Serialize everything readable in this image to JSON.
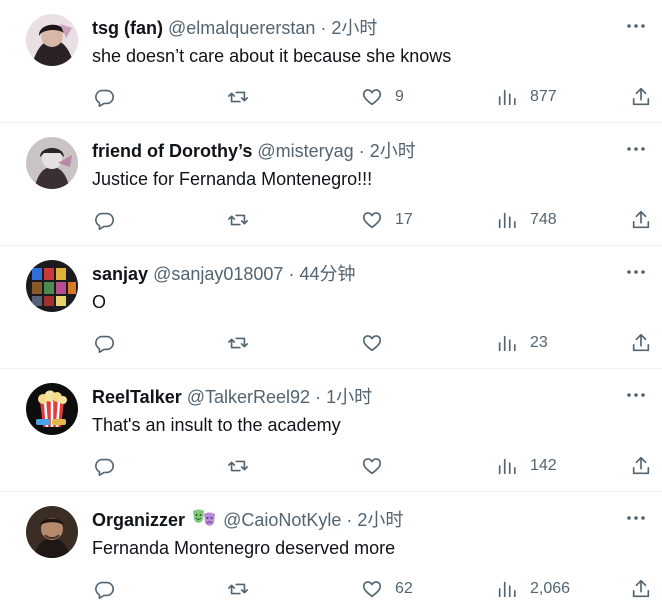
{
  "tweets": [
    {
      "name": "tsg (fan)",
      "handle": "@elmalquererstan",
      "separator": "·",
      "time": "2小时",
      "text": "she doesn’t care about it because she knows",
      "likes": "9",
      "views": "877",
      "has_emoji": false
    },
    {
      "name": "friend of Dorothy’s",
      "handle": "@misteryag",
      "separator": "·",
      "time": "2小时",
      "text": "Justice for Fernanda Montenegro!!!",
      "likes": "17",
      "views": "748",
      "has_emoji": false
    },
    {
      "name": "sanjay",
      "handle": "@sanjay018007",
      "separator": "·",
      "time": "44分钟",
      "text": "O",
      "likes": "",
      "views": "23",
      "has_emoji": false
    },
    {
      "name": "ReelTalker",
      "handle": "@TalkerReel92",
      "separator": "·",
      "time": "1小时",
      "text": "That's an insult to the academy",
      "likes": "",
      "views": "142",
      "has_emoji": false
    },
    {
      "name": "Organizzer",
      "handle": "@CaioNotKyle",
      "separator": "·",
      "time": "2小时",
      "text": "Fernanda Montenegro deserved more",
      "likes": "62",
      "views": "2,066",
      "has_emoji": true
    }
  ],
  "icons": {
    "more": "more-icon",
    "reply": "reply-icon",
    "retweet": "retweet-icon",
    "like": "heart-icon",
    "views": "views-icon",
    "share": "share-icon",
    "emoji": "theater-masks-icon"
  },
  "colors": {
    "text": "#0f1419",
    "secondary": "#536471",
    "divider": "#eff3f4"
  }
}
